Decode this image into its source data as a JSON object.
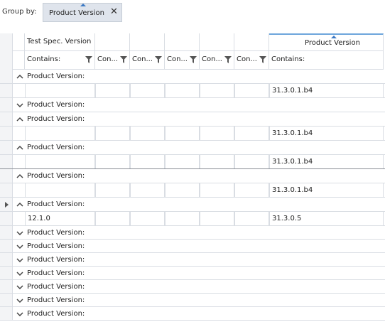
{
  "groupbar": {
    "label": "Group by:",
    "chip_label": "Product Version",
    "close_glyph": "✕"
  },
  "columns": {
    "headers": [
      "Test Spec. Version",
      "",
      "",
      "",
      "",
      "",
      "Product Version"
    ],
    "filters": [
      "Contains:",
      "Con...",
      "Con...",
      "Con...",
      "Con...",
      "Con...",
      "Contains:"
    ]
  },
  "rows": [
    {
      "kind": "group",
      "label": "Product Version:",
      "expanded": true
    },
    {
      "kind": "data",
      "cells": [
        "",
        "",
        "",
        "",
        "",
        "",
        "31.3.0.1.b4"
      ]
    },
    {
      "kind": "group",
      "label": "Product Version:",
      "expanded": false
    },
    {
      "kind": "group",
      "label": "Product Version:",
      "expanded": true
    },
    {
      "kind": "data",
      "cells": [
        "",
        "",
        "",
        "",
        "",
        "",
        "31.3.0.1.b4"
      ]
    },
    {
      "kind": "group",
      "label": "Product Version:",
      "expanded": true
    },
    {
      "kind": "data",
      "cells": [
        "",
        "",
        "",
        "",
        "",
        "",
        "31.3.0.1.b4"
      ],
      "dark": true
    },
    {
      "kind": "group",
      "label": "Product Version:",
      "expanded": true
    },
    {
      "kind": "data",
      "cells": [
        "",
        "",
        "",
        "",
        "",
        "",
        "31.3.0.1.b4"
      ]
    },
    {
      "kind": "group",
      "label": "Product Version:",
      "expanded": true,
      "current": true
    },
    {
      "kind": "data",
      "cells": [
        "12.1.0",
        "",
        "",
        "",
        "",
        "",
        "31.3.0.5"
      ]
    },
    {
      "kind": "group",
      "label": "Product Version:",
      "expanded": false
    },
    {
      "kind": "group",
      "label": "Product Version:",
      "expanded": false
    },
    {
      "kind": "group",
      "label": "Product Version:",
      "expanded": false
    },
    {
      "kind": "group",
      "label": "Product Version:",
      "expanded": false
    },
    {
      "kind": "group",
      "label": "Product Version:",
      "expanded": false
    },
    {
      "kind": "group",
      "label": "Product Version:",
      "expanded": false
    },
    {
      "kind": "group",
      "label": "Product Version:",
      "expanded": false
    }
  ]
}
